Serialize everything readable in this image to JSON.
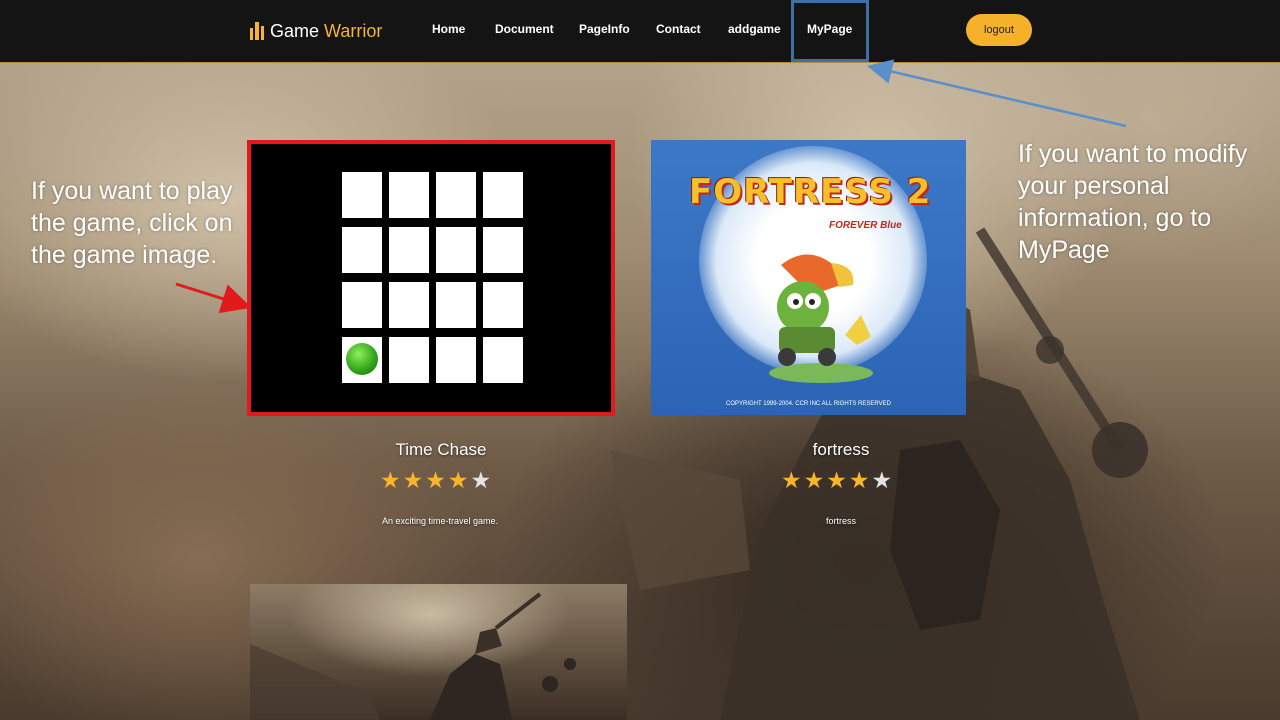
{
  "header": {
    "logo_word1": "Game",
    "logo_word2": "Warrior",
    "nav": [
      "Home",
      "Document",
      "PageInfo",
      "Contact",
      "addgame",
      "MyPage"
    ],
    "logout_label": "logout",
    "accent_color": "#f7b42c"
  },
  "games": [
    {
      "title": "Time Chase",
      "rating": 4,
      "max_rating": 5,
      "description": "An exciting time-travel game."
    },
    {
      "title": "fortress",
      "rating": 4,
      "max_rating": 5,
      "description": "fortress",
      "image_title": "FORTRESS 2",
      "image_subtitle": "FOREVER Blue",
      "image_copyright": "COPYRIGHT 1999-2004. CCR INC ALL RIGHTS RESERVED"
    }
  ],
  "annotations": {
    "left": "If you want to play the game, click on the game image.",
    "right": "If you want to modify your personal information, go to MyPage"
  },
  "colors": {
    "highlight_red": "#e11b1b",
    "highlight_blue": "#3e6fa5",
    "arrow_blue": "#5b8fc9"
  }
}
